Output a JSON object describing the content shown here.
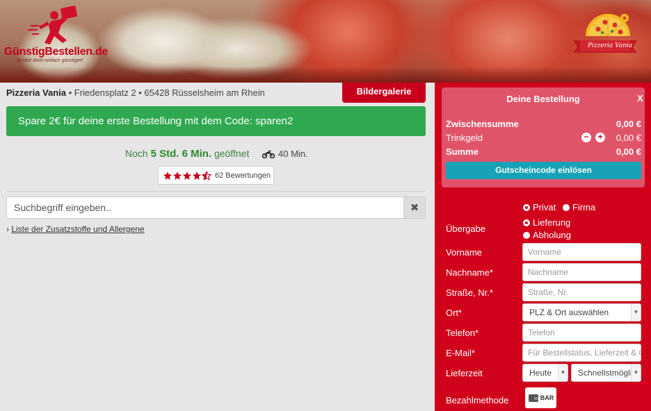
{
  "header": {
    "logo_text": "GünstigBestellen.de",
    "logo_tagline": "Bestell doch einfach günstiger!",
    "restaurant_logo_text": "Pizzeria Vania"
  },
  "restaurant": {
    "name": "Pizzeria Vania",
    "address": " • Friedensplatz 2 • 65428 Rüsselsheim am Rhein",
    "gallery_label": "Bildergalerie",
    "promo": "Spare 2€ für deine erste Bestellung mit dem Code: sparen2",
    "status_prefix": "Noch ",
    "status_time": "5 Std. 6 Min.",
    "status_suffix": " geöffnet",
    "delivery_time": "40 Min.",
    "rating_value": 4.5,
    "rating_count": "62 Bewertungen"
  },
  "search": {
    "placeholder": "Suchbegriff eingeben..",
    "clear_icon": "close-icon"
  },
  "allergen_link": "Liste der Zusatzstoffe und Allergene",
  "order": {
    "title": "Deine Bestellung",
    "close": "X",
    "subtotal_label": "Zwischensumme",
    "subtotal_value": "0,00 €",
    "tip_label": "Trinkgeld",
    "tip_value": "0,00 €",
    "total_label": "Summe",
    "total_value": "0,00 €",
    "voucher_button": "Gutscheincode einlösen"
  },
  "form": {
    "customer_type": {
      "options": [
        "Privat",
        "Firma"
      ],
      "selected": "Privat"
    },
    "handover": {
      "label": "Übergabe",
      "options": [
        "Lieferung",
        "Abholung"
      ],
      "selected": "Lieferung"
    },
    "first_name": {
      "label": "Vorname",
      "placeholder": "Vorname"
    },
    "last_name": {
      "label": "Nachname*",
      "placeholder": "Nachname"
    },
    "street": {
      "label": "Straße, Nr.*",
      "placeholder": "Straße, Nr."
    },
    "city": {
      "label": "Ort*",
      "value": "PLZ & Ort auswählen"
    },
    "phone": {
      "label": "Telefon*",
      "placeholder": "Telefon"
    },
    "email": {
      "label": "E-Mail*",
      "placeholder": "Für Bestellstatus, Lieferzeit & Gutschein"
    },
    "delivery_time": {
      "label": "Lieferzeit",
      "day": "Heute",
      "time": "Schnellstmöglich"
    },
    "payment": {
      "label": "Bezahlmethode",
      "option": "BAR"
    }
  },
  "colors": {
    "brand_red": "#d0021b",
    "promo_green": "#2fa84f",
    "voucher_teal": "#17a2b8",
    "star_red": "#c8001c"
  }
}
